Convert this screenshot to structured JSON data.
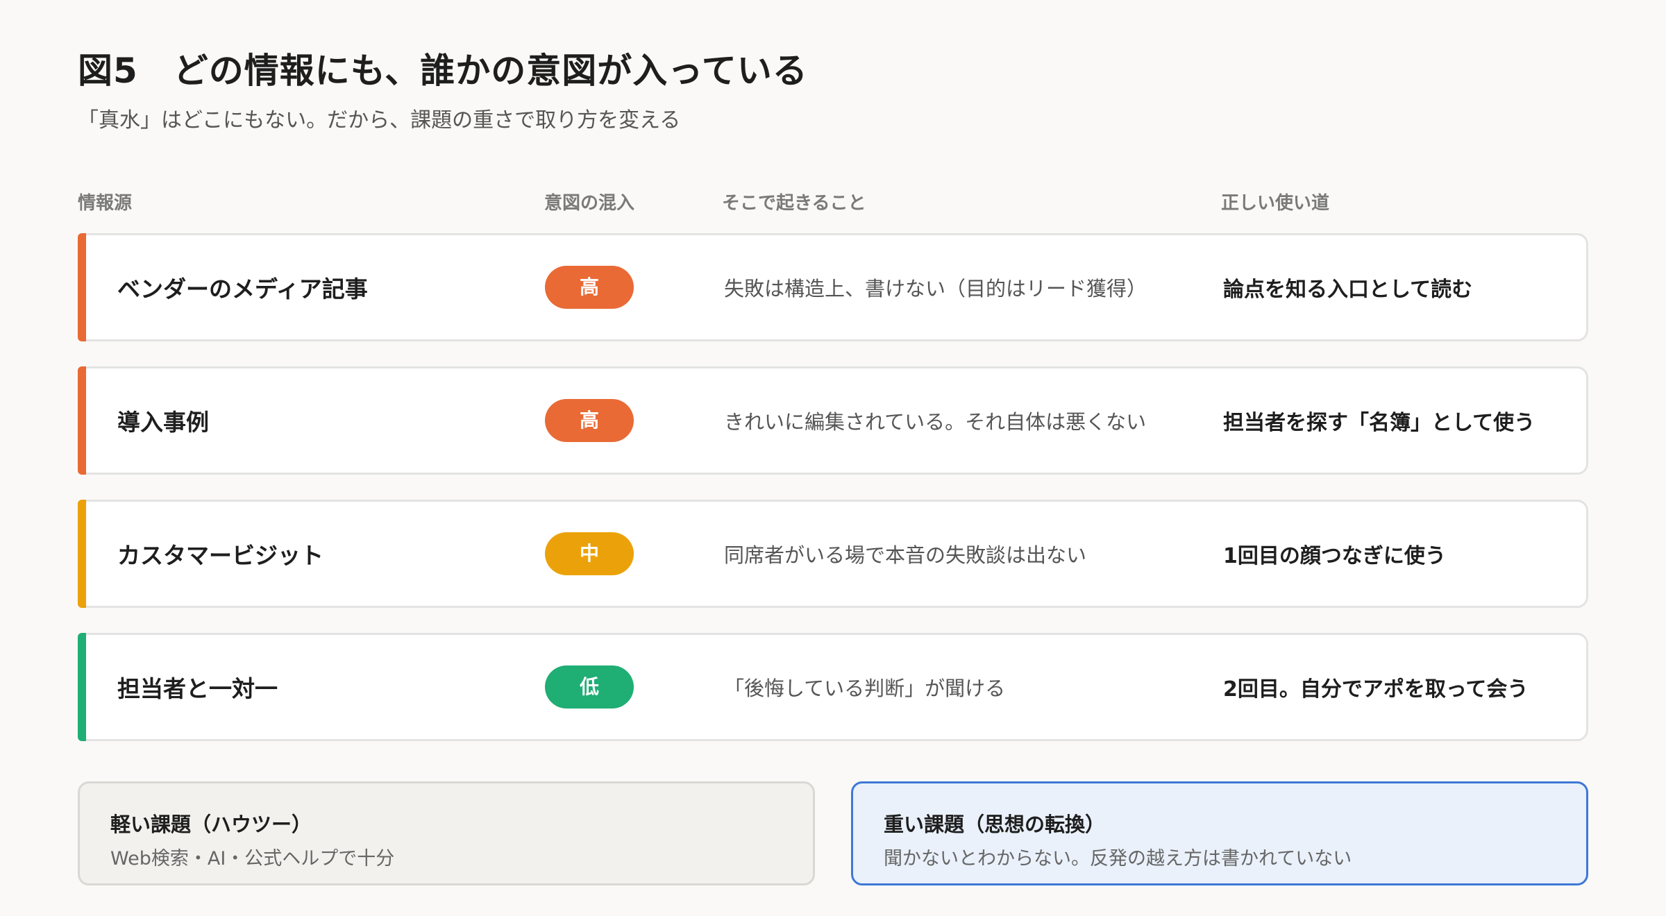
{
  "header": {
    "title": "図5　どの情報にも、誰かの意図が入っている",
    "subtitle": "「真水」はどこにもない。だから、課題の重さで取り方を変える"
  },
  "columns": {
    "source": "情報源",
    "intent": "意図の混入",
    "effect": "そこで起きること",
    "usage": "正しい使い道"
  },
  "rows": [
    {
      "source": "ベンダーのメディア記事",
      "intent_level": "高",
      "intent_color": "#e96a35",
      "effect": "失敗は構造上、書けない（目的はリード獲得）",
      "usage": "論点を知る入口として読む"
    },
    {
      "source": "導入事例",
      "intent_level": "高",
      "intent_color": "#e96a35",
      "effect": "きれいに編集されている。それ自体は悪くない",
      "usage": "担当者を探す「名簿」として使う"
    },
    {
      "source": "カスタマービジット",
      "intent_level": "中",
      "intent_color": "#eba20a",
      "effect": "同席者がいる場で本音の失敗談は出ない",
      "usage": "1回目の顔つなぎに使う"
    },
    {
      "source": "担当者と一対一",
      "intent_level": "低",
      "intent_color": "#1fae74",
      "effect": "「後悔している判断」が聞ける",
      "usage": "2回目。自分でアポを取って会う"
    }
  ],
  "cards": {
    "light": {
      "title": "軽い課題（ハウツー）",
      "desc": "Web検索・AI・公式ヘルプで十分"
    },
    "heavy": {
      "title": "重い課題（思想の転換）",
      "desc": "聞かないとわからない。反発の越え方は書かれていない"
    }
  }
}
